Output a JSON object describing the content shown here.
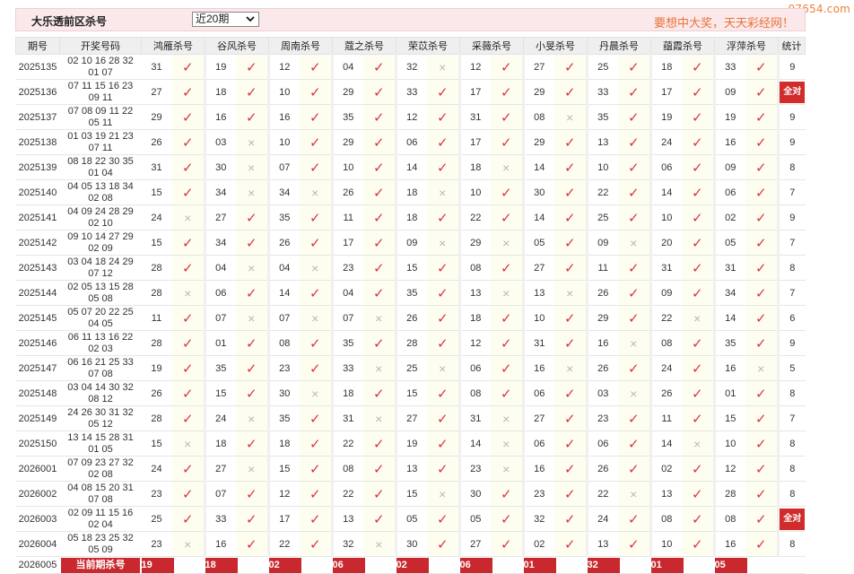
{
  "watermark": "97654.com",
  "header": {
    "title": "大乐透前区杀号",
    "period_select": "近20期",
    "slogan": "要想中大奖，天天彩经网！"
  },
  "columns": {
    "issue": "期号",
    "draw": "开奖号码",
    "experts": [
      "鸿雁杀号",
      "谷风杀号",
      "周南杀号",
      "蔻之杀号",
      "荣苡杀号",
      "采薇杀号",
      "小旻杀号",
      "丹晨杀号",
      "蕴霞杀号",
      "浮萍杀号"
    ],
    "stat": "统计"
  },
  "rows": [
    {
      "issue": "2025135",
      "front": "02 10 16 28 32",
      "back": "01 07",
      "kills": [
        "31",
        "19",
        "12",
        "04",
        "32",
        "12",
        "27",
        "25",
        "18",
        "33"
      ],
      "marks": [
        1,
        1,
        1,
        1,
        0,
        1,
        1,
        1,
        1,
        1
      ],
      "stat": "9"
    },
    {
      "issue": "2025136",
      "front": "07 11 15 16 23",
      "back": "09 11",
      "kills": [
        "27",
        "18",
        "10",
        "29",
        "33",
        "17",
        "29",
        "33",
        "17",
        "09"
      ],
      "marks": [
        1,
        1,
        1,
        1,
        1,
        1,
        1,
        1,
        1,
        1
      ],
      "stat": "全对"
    },
    {
      "issue": "2025137",
      "front": "07 08 09 11 22",
      "back": "05 11",
      "kills": [
        "29",
        "16",
        "16",
        "35",
        "12",
        "31",
        "08",
        "35",
        "19",
        "19"
      ],
      "marks": [
        1,
        1,
        1,
        1,
        1,
        1,
        0,
        1,
        1,
        1
      ],
      "stat": "9"
    },
    {
      "issue": "2025138",
      "front": "01 03 19 21 23",
      "back": "07 11",
      "kills": [
        "26",
        "03",
        "10",
        "29",
        "06",
        "17",
        "29",
        "13",
        "24",
        "16"
      ],
      "marks": [
        1,
        0,
        1,
        1,
        1,
        1,
        1,
        1,
        1,
        1
      ],
      "stat": "9"
    },
    {
      "issue": "2025139",
      "front": "08 18 22 30 35",
      "back": "01 04",
      "kills": [
        "31",
        "30",
        "07",
        "10",
        "14",
        "18",
        "14",
        "10",
        "06",
        "09"
      ],
      "marks": [
        1,
        0,
        1,
        1,
        1,
        0,
        1,
        1,
        1,
        1
      ],
      "stat": "8"
    },
    {
      "issue": "2025140",
      "front": "04 05 13 18 34",
      "back": "02 08",
      "kills": [
        "15",
        "34",
        "34",
        "26",
        "18",
        "10",
        "30",
        "22",
        "14",
        "06"
      ],
      "marks": [
        1,
        0,
        0,
        1,
        0,
        1,
        1,
        1,
        1,
        1
      ],
      "stat": "7"
    },
    {
      "issue": "2025141",
      "front": "04 09 24 28 29",
      "back": "02 10",
      "kills": [
        "24",
        "27",
        "35",
        "11",
        "18",
        "22",
        "14",
        "25",
        "10",
        "02"
      ],
      "marks": [
        0,
        1,
        1,
        1,
        1,
        1,
        1,
        1,
        1,
        1
      ],
      "stat": "9"
    },
    {
      "issue": "2025142",
      "front": "09 10 14 27 29",
      "back": "02 09",
      "kills": [
        "15",
        "34",
        "26",
        "17",
        "09",
        "29",
        "05",
        "09",
        "20",
        "05"
      ],
      "marks": [
        1,
        1,
        1,
        1,
        0,
        0,
        1,
        0,
        1,
        1
      ],
      "stat": "7"
    },
    {
      "issue": "2025143",
      "front": "03 04 18 24 29",
      "back": "07 12",
      "kills": [
        "28",
        "04",
        "04",
        "23",
        "15",
        "08",
        "27",
        "11",
        "31",
        "31"
      ],
      "marks": [
        1,
        0,
        0,
        1,
        1,
        1,
        1,
        1,
        1,
        1
      ],
      "stat": "8"
    },
    {
      "issue": "2025144",
      "front": "02 05 13 15 28",
      "back": "05 08",
      "kills": [
        "28",
        "06",
        "14",
        "04",
        "35",
        "13",
        "13",
        "26",
        "09",
        "34"
      ],
      "marks": [
        0,
        1,
        1,
        1,
        1,
        0,
        0,
        1,
        1,
        1
      ],
      "stat": "7"
    },
    {
      "issue": "2025145",
      "front": "05 07 20 22 25",
      "back": "04 05",
      "kills": [
        "11",
        "07",
        "07",
        "07",
        "26",
        "18",
        "10",
        "29",
        "22",
        "14"
      ],
      "marks": [
        1,
        0,
        0,
        0,
        1,
        1,
        1,
        1,
        0,
        1
      ],
      "stat": "6"
    },
    {
      "issue": "2025146",
      "front": "06 11 13 16 22",
      "back": "02 03",
      "kills": [
        "28",
        "01",
        "08",
        "35",
        "28",
        "12",
        "31",
        "16",
        "08",
        "35"
      ],
      "marks": [
        1,
        1,
        1,
        1,
        1,
        1,
        1,
        0,
        1,
        1
      ],
      "stat": "9"
    },
    {
      "issue": "2025147",
      "front": "06 16 21 25 33",
      "back": "07 08",
      "kills": [
        "19",
        "35",
        "23",
        "33",
        "25",
        "06",
        "16",
        "26",
        "24",
        "16"
      ],
      "marks": [
        1,
        1,
        1,
        0,
        0,
        1,
        0,
        1,
        1,
        0
      ],
      "stat": "5"
    },
    {
      "issue": "2025148",
      "front": "03 04 14 30 32",
      "back": "08 12",
      "kills": [
        "26",
        "15",
        "30",
        "18",
        "15",
        "08",
        "06",
        "03",
        "26",
        "01"
      ],
      "marks": [
        1,
        1,
        0,
        1,
        1,
        1,
        1,
        0,
        1,
        1
      ],
      "stat": "8"
    },
    {
      "issue": "2025149",
      "front": "24 26 30 31 32",
      "back": "05 12",
      "kills": [
        "28",
        "24",
        "35",
        "31",
        "27",
        "31",
        "27",
        "23",
        "11",
        "15"
      ],
      "marks": [
        1,
        0,
        1,
        0,
        1,
        0,
        1,
        1,
        1,
        1
      ],
      "stat": "7"
    },
    {
      "issue": "2025150",
      "front": "13 14 15 28 31",
      "back": "01 05",
      "kills": [
        "15",
        "18",
        "18",
        "22",
        "19",
        "14",
        "06",
        "06",
        "14",
        "10"
      ],
      "marks": [
        0,
        1,
        1,
        1,
        1,
        0,
        1,
        1,
        0,
        1
      ],
      "stat": "8"
    },
    {
      "issue": "2026001",
      "front": "07 09 23 27 32",
      "back": "02 08",
      "kills": [
        "24",
        "27",
        "15",
        "08",
        "13",
        "23",
        "16",
        "26",
        "02",
        "12"
      ],
      "marks": [
        1,
        0,
        1,
        1,
        1,
        0,
        1,
        1,
        1,
        1
      ],
      "stat": "8"
    },
    {
      "issue": "2026002",
      "front": "04 08 15 20 31",
      "back": "07 08",
      "kills": [
        "23",
        "07",
        "12",
        "22",
        "15",
        "30",
        "23",
        "22",
        "13",
        "28"
      ],
      "marks": [
        1,
        1,
        1,
        1,
        0,
        1,
        1,
        0,
        1,
        1
      ],
      "stat": "8"
    },
    {
      "issue": "2026003",
      "front": "02 09 11 15 16",
      "back": "02 04",
      "kills": [
        "25",
        "33",
        "17",
        "13",
        "05",
        "05",
        "32",
        "24",
        "08",
        "08"
      ],
      "marks": [
        1,
        1,
        1,
        1,
        1,
        1,
        1,
        1,
        1,
        1
      ],
      "stat": "全对"
    },
    {
      "issue": "2026004",
      "front": "05 18 23 25 32",
      "back": "05 09",
      "kills": [
        "23",
        "16",
        "22",
        "32",
        "30",
        "27",
        "02",
        "13",
        "10",
        "16"
      ],
      "marks": [
        0,
        1,
        1,
        0,
        1,
        1,
        1,
        1,
        1,
        1
      ],
      "stat": "8"
    }
  ],
  "current": {
    "issue": "2026005",
    "label": "当前期杀号",
    "kills": [
      "19",
      "18",
      "02",
      "06",
      "02",
      "06",
      "01",
      "32",
      "01",
      "05"
    ]
  },
  "marks": {
    "correct": "✓",
    "wrong": "×"
  }
}
